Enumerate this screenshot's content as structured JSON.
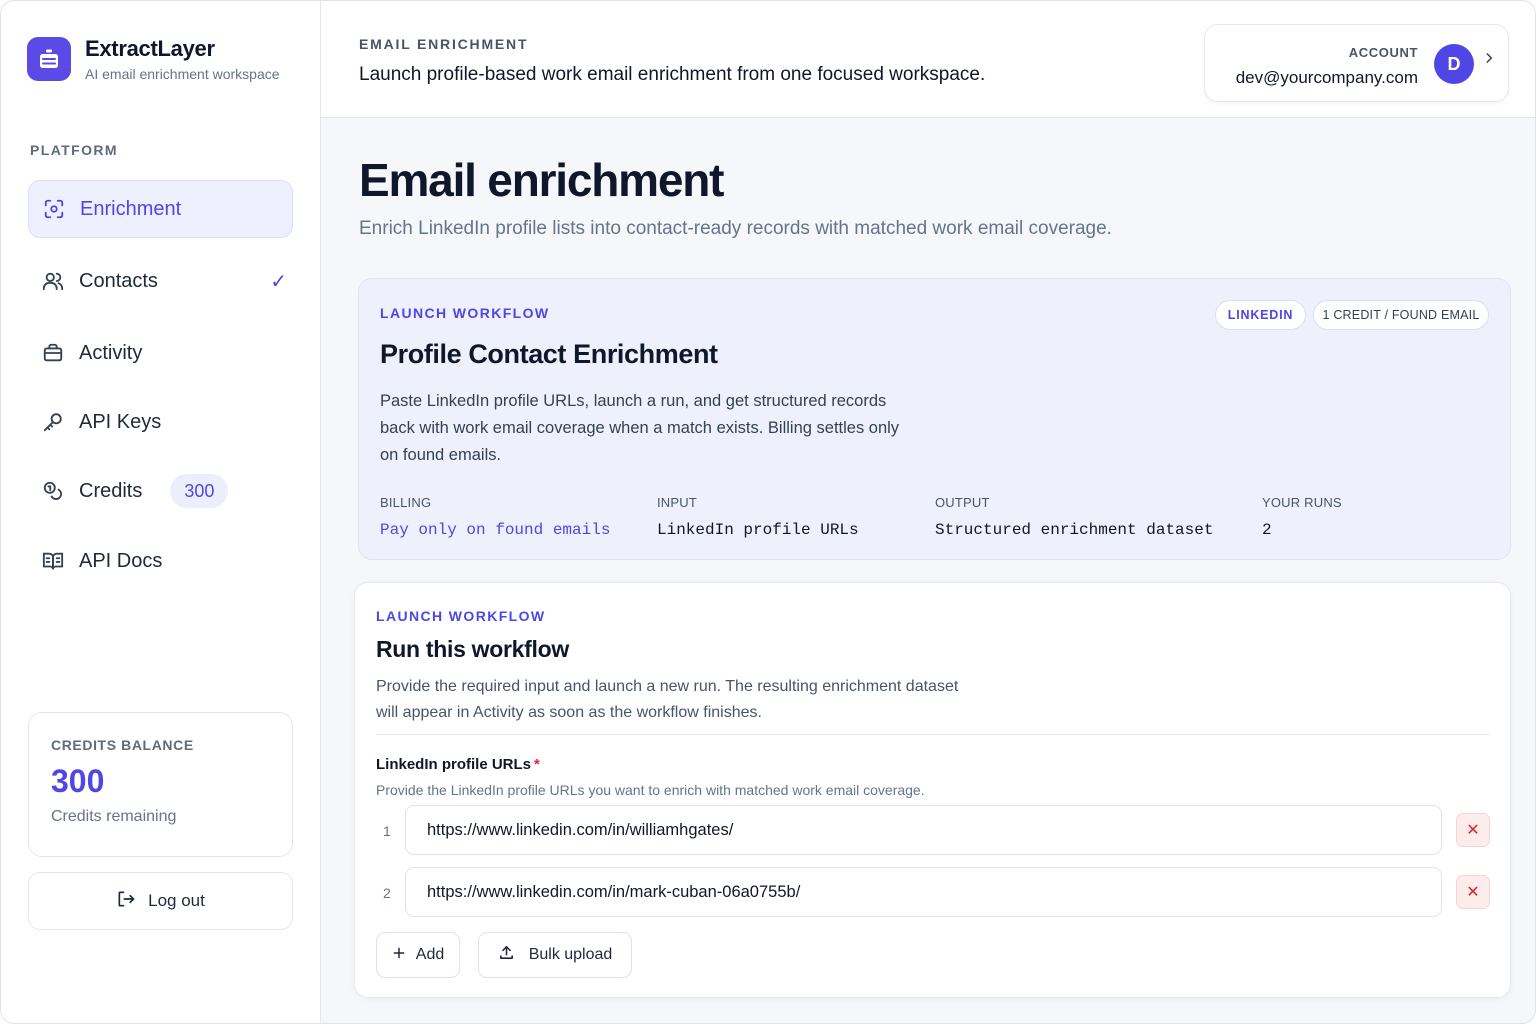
{
  "brand": {
    "name": "ExtractLayer",
    "subtitle": "AI email enrichment workspace"
  },
  "sidebar": {
    "section_label": "PLATFORM",
    "items": [
      {
        "label": "Enrichment",
        "icon": "scan-icon",
        "active": true
      },
      {
        "label": "Contacts",
        "icon": "users-icon",
        "checked": true
      },
      {
        "label": "Activity",
        "icon": "briefcase-icon"
      },
      {
        "label": "API Keys",
        "icon": "key-icon"
      },
      {
        "label": "Credits",
        "icon": "coins-icon",
        "badge": "300"
      },
      {
        "label": "API Docs",
        "icon": "book-icon"
      }
    ],
    "credits_card": {
      "label": "CREDITS BALANCE",
      "value": "300",
      "sub": "Credits remaining"
    },
    "logout_label": "Log out"
  },
  "topbar": {
    "kicker": "EMAIL ENRICHMENT",
    "title": "Launch profile-based work email enrichment from one focused workspace.",
    "account": {
      "label": "ACCOUNT",
      "email": "dev@yourcompany.com",
      "avatar_initial": "D"
    }
  },
  "page": {
    "title": "Email enrichment",
    "subtitle": "Enrich LinkedIn profile lists into contact-ready records with matched work email coverage."
  },
  "workflow_card": {
    "kicker": "LAUNCH WORKFLOW",
    "title": "Profile Contact Enrichment",
    "description": "Paste LinkedIn profile URLs, launch a run, and get structured records back with work email coverage when a match exists. Billing settles only on found emails.",
    "pills": [
      "LINKEDIN",
      "1 CREDIT / FOUND EMAIL"
    ],
    "meta": [
      {
        "label": "BILLING",
        "value": "Pay only on found emails"
      },
      {
        "label": "INPUT",
        "value": "LinkedIn profile URLs"
      },
      {
        "label": "OUTPUT",
        "value": "Structured enrichment dataset"
      },
      {
        "label": "YOUR RUNS",
        "value": "2"
      }
    ]
  },
  "run_card": {
    "kicker": "LAUNCH WORKFLOW",
    "title": "Run this workflow",
    "description": "Provide the required input and launch a new run. The resulting enrichment dataset will appear in Activity as soon as the workflow finishes.",
    "field": {
      "label": "LinkedIn profile URLs",
      "required_mark": "*",
      "help": "Provide the LinkedIn profile URLs you want to enrich with matched work email coverage.",
      "rows": [
        {
          "num": "1",
          "value": "https://www.linkedin.com/in/williamhgates/"
        },
        {
          "num": "2",
          "value": "https://www.linkedin.com/in/mark-cuban-06a0755b/"
        }
      ]
    },
    "add_label": "Add",
    "bulk_label": "Bulk upload"
  },
  "colors": {
    "accent": "#4f46e5",
    "danger": "#dc2626"
  }
}
